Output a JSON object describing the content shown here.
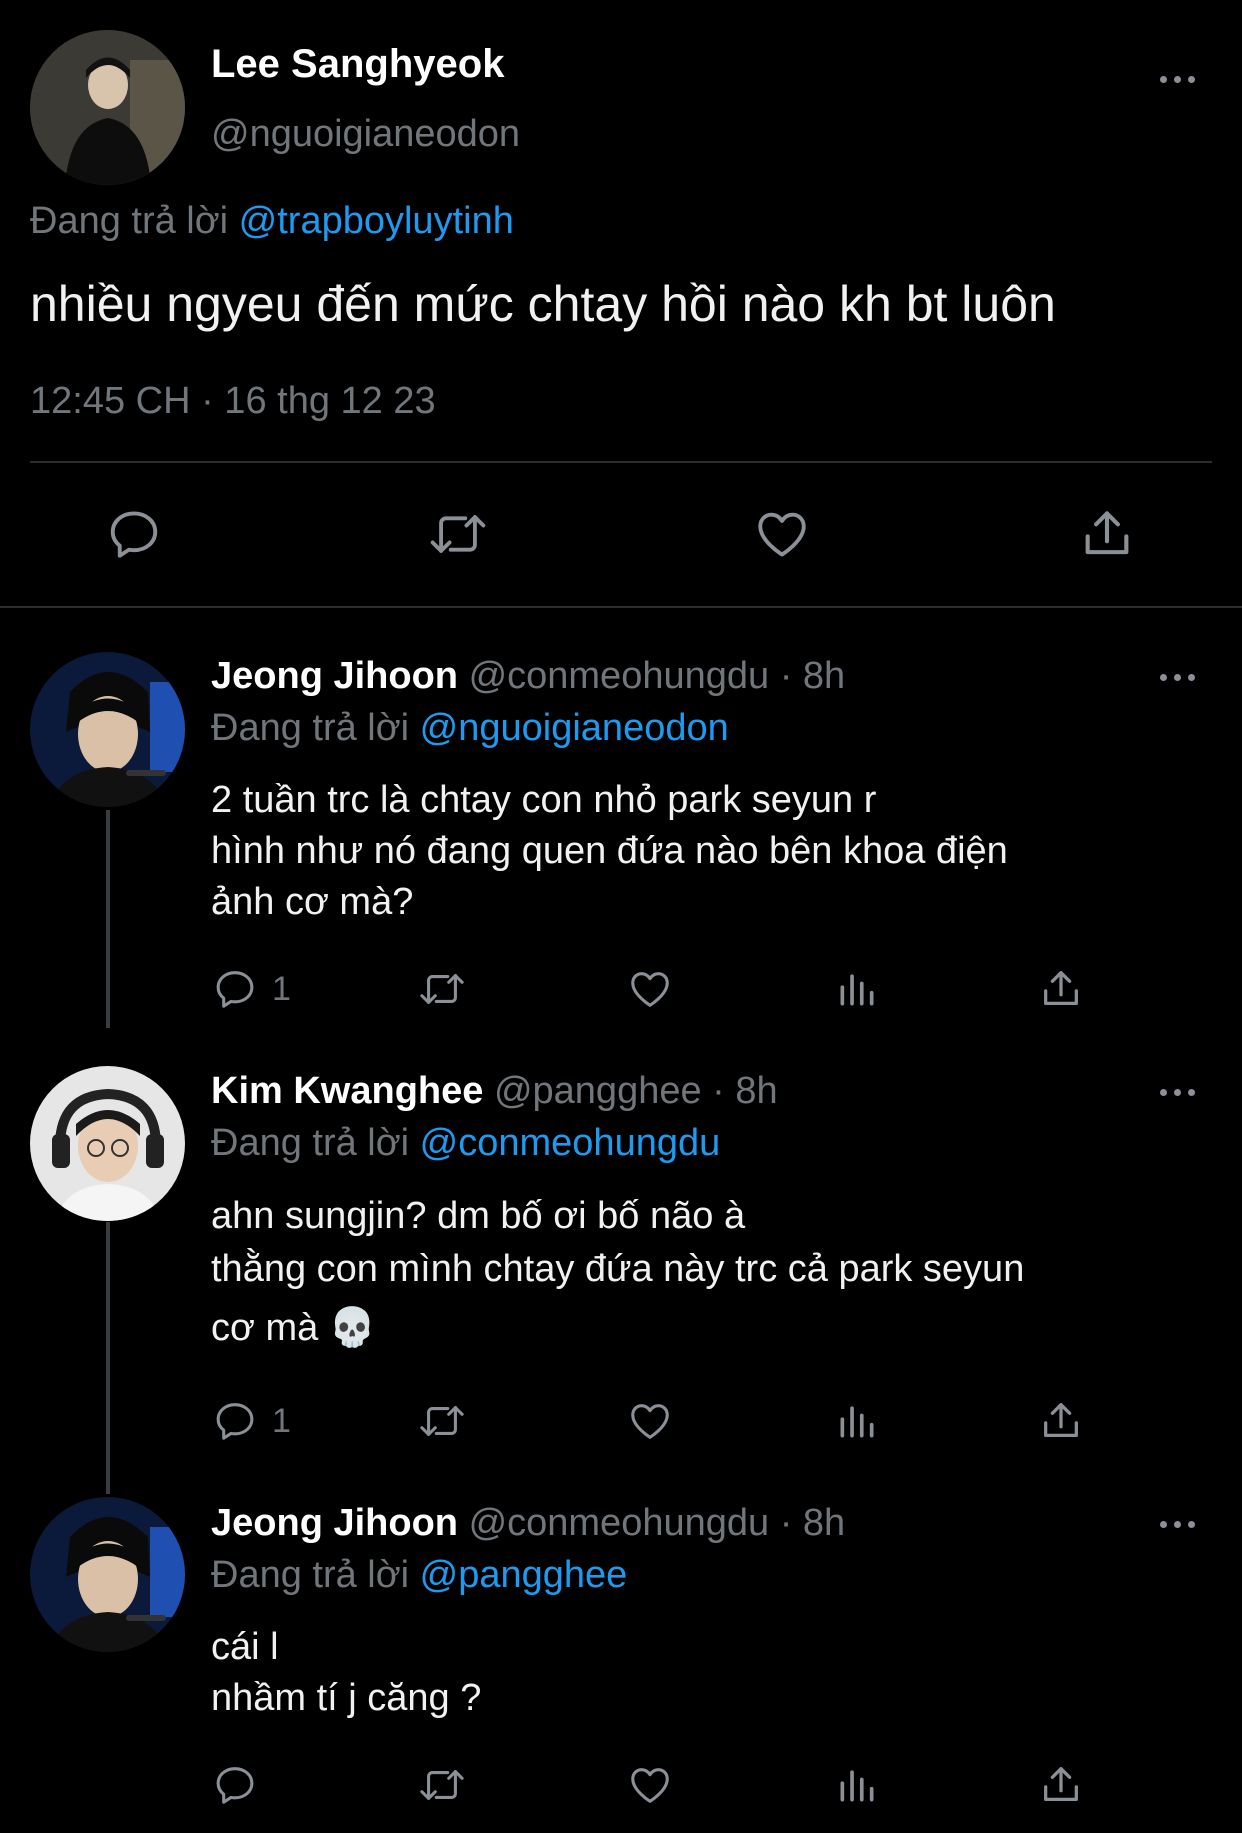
{
  "main_tweet": {
    "name": "Lee Sanghyeok",
    "handle": "@nguoigianeodon",
    "reply_label": "Đang trả lời",
    "reply_to": "@trapboyluytinh",
    "text": "nhiều ngyeu đến mức chtay hồi nào kh bt luôn",
    "timestamp": "12:45 CH · 16 thg 12 23",
    "actions": [
      "reply-icon",
      "retweet-icon",
      "like-icon",
      "share-icon"
    ]
  },
  "replies": [
    {
      "name": "Jeong Jihoon",
      "meta": "@conmeohungdu · 8h",
      "reply_label": "Đang trả lời",
      "reply_to": "@nguoigianeodon",
      "lines": [
        "2 tuần trc là chtay con nhỏ park seyun r",
        "hình như nó đang quen đứa nào bên khoa điện",
        "ảnh cơ mà?"
      ],
      "reply_count": "1"
    },
    {
      "name": "Kim Kwanghee",
      "meta": "@pangghee · 8h",
      "reply_label": "Đang trả lời",
      "reply_to": "@conmeohungdu",
      "lines": [
        "ahn sungjin? dm bố ơi bố não à",
        "thằng con mình chtay đứa này trc cả park seyun",
        "cơ mà 💀"
      ],
      "reply_count": "1"
    },
    {
      "name": "Jeong Jihoon",
      "meta": "@conmeohungdu · 8h",
      "reply_label": "Đang trả lời",
      "reply_to": "@pangghee",
      "lines": [
        "cái l",
        "nhầm tí j căng ?"
      ],
      "reply_count": ""
    }
  ],
  "colors": {
    "background": "#000000",
    "text": "#e7e9ea",
    "secondary": "#71767b",
    "link": "#1d9bf0"
  }
}
